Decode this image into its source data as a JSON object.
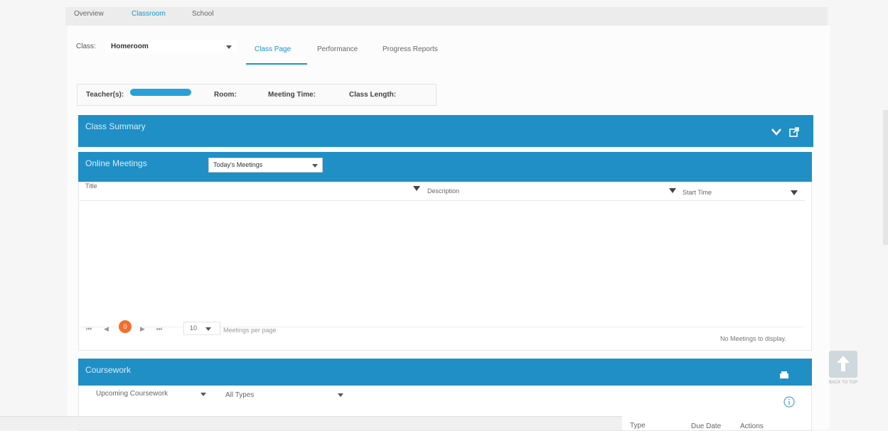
{
  "top_tabs": [
    "Overview",
    "Classroom",
    "School"
  ],
  "class_selector": {
    "label": "Class:",
    "value": "Homeroom"
  },
  "sub_tabs": [
    "Class Page",
    "Performance",
    "Progress Reports"
  ],
  "info": {
    "teacher": "Teacher(s):",
    "room": "Room:",
    "meeting_time": "Meeting Time:",
    "class_length": "Class Length:"
  },
  "class_summary": {
    "title": "Class Summary"
  },
  "online_meetings": {
    "title": "Online Meetings",
    "filter_value": "Today's Meetings",
    "columns": [
      "Title",
      "Description",
      "Start Time"
    ],
    "pager": {
      "current_page": "0",
      "page_size": "10",
      "per_page_label": "Meetings per page"
    },
    "empty_message": "No Meetings to display."
  },
  "coursework": {
    "title": "Coursework",
    "filter1": "Upcoming Coursework",
    "filter2": "All Types",
    "columns": [
      "Type",
      "Due Date",
      "Actions"
    ]
  },
  "back_to_top": "BACK TO TOP",
  "colors": {
    "accent": "#1f8fc6",
    "active_tab": "#1b95c9",
    "page_badge": "#f36f2d"
  }
}
